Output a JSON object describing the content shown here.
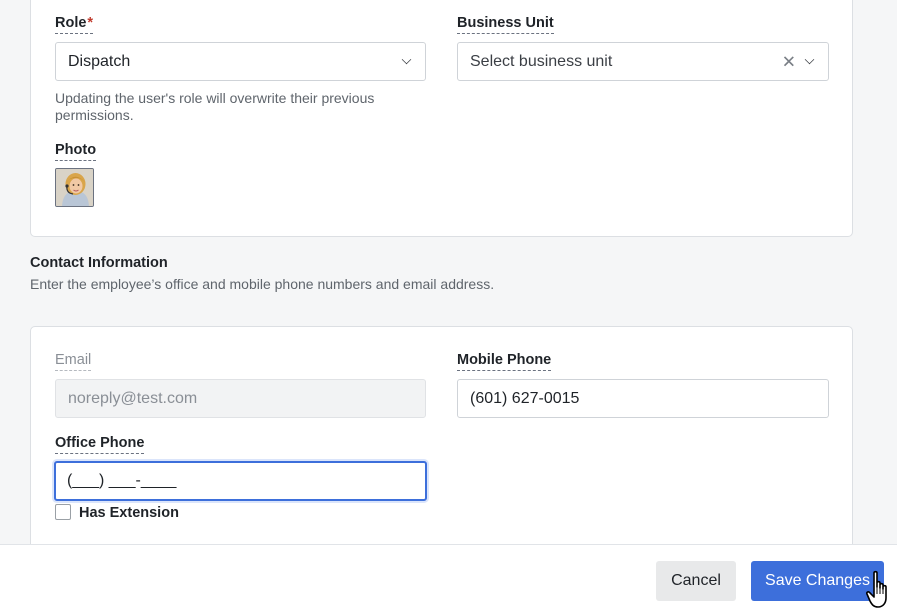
{
  "role": {
    "label": "Role",
    "required_mark": "*",
    "value": "Dispatch",
    "help": "Updating the user's role will overwrite their previous permissions."
  },
  "business_unit": {
    "label": "Business Unit",
    "placeholder": "Select business unit"
  },
  "photo": {
    "label": "Photo"
  },
  "contact": {
    "title": "Contact Information",
    "description": "Enter the employee’s office and mobile phone numbers and email address."
  },
  "email": {
    "label": "Email",
    "value": "noreply@test.com"
  },
  "mobile_phone": {
    "label": "Mobile Phone",
    "value": "(601) 627-0015"
  },
  "office_phone": {
    "label": "Office Phone",
    "value": "(___) ___-____"
  },
  "has_extension": {
    "label": "Has Extension",
    "checked": false
  },
  "footer": {
    "cancel_label": "Cancel",
    "save_label": "Save Changes"
  },
  "colors": {
    "primary": "#3d6fdb",
    "required": "#c0392b",
    "focus_border": "#3d6fdb"
  }
}
